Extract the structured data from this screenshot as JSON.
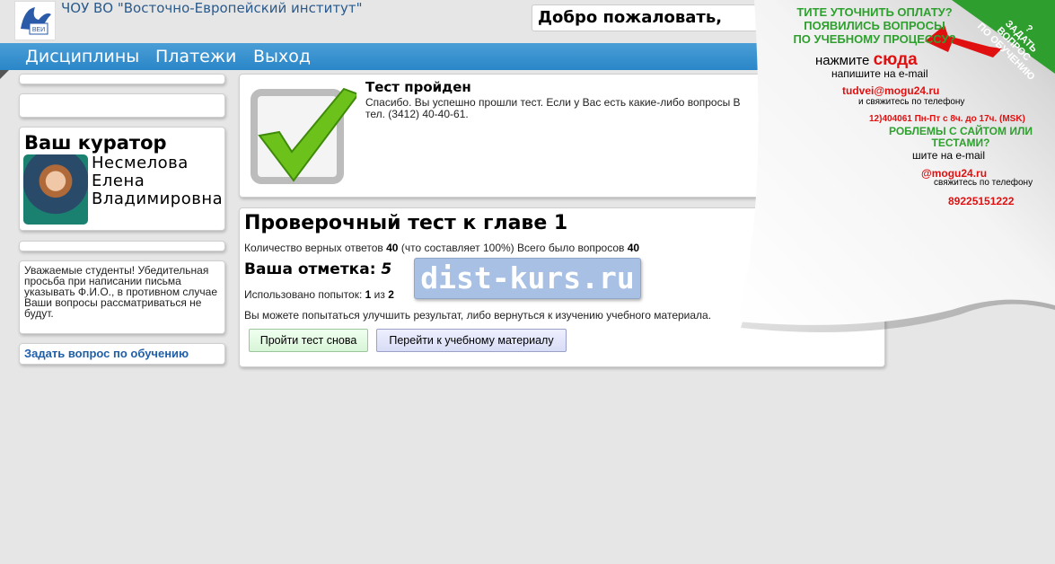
{
  "header": {
    "institute_name": "ЧОУ ВО \"Восточно-Европейский институт\"",
    "logo_text": "ВЕИ",
    "welcome": "Добро пожаловать,"
  },
  "nav": [
    "Дисциплины",
    "Платежи",
    "Выход"
  ],
  "curator": {
    "title": "Ваш куратор",
    "name_lines": [
      "Несмелова",
      "Елена",
      "Владимировна"
    ]
  },
  "notice": "Уважаемые студенты! Убедительная просьба при написании письма указывать Ф.И.О., в противном случае Ваши вопросы рассматриваться не будут.",
  "ask_link": "Задать вопрос по обучению",
  "passed": {
    "title": "Тест пройден",
    "text_1": "Спасибо. Вы успешно прошли тест. Если у Вас есть какие-либо вопросы В",
    "text_2": "тел. (3412) 40-40-61."
  },
  "test": {
    "title": "Проверочный тест к главе 1",
    "correct_label": "Количество верных ответов",
    "correct": "40",
    "percent_text": "(что составляет 100%) Всего было вопросов",
    "total": "40",
    "grade_label": "Ваша отметка:",
    "grade": "5",
    "attempts_label": "Использовано попыток:",
    "attempts_used": "1",
    "attempts_of": "из",
    "attempts_total": "2",
    "hint": "Вы можете попытаться улучшить результат, либо вернуться к изучению учебного материала.",
    "retry_button": "Пройти тест снова",
    "material_button": "Перейти к учебному материалу"
  },
  "watermark": "dist-kurs.ru",
  "promo": {
    "ribbon": [
      "?",
      "ЗАДАТЬ",
      "ВОПРОС",
      "ПО ОБУЧЕНИЮ"
    ],
    "q1": "ТИТЕ УТОЧНИТЬ ОПЛАТУ?",
    "q2": "ПОЯВИЛИСЬ ВОПРОСЫ",
    "q3": "ПО УЧЕБНОМУ ПРОЦЕССУ?",
    "press": "нажмите",
    "here": "сюда",
    "write": "напишите на e-mail",
    "email1": "tudvei@mogu24.ru",
    "call1": "и свяжитесь по телефону",
    "phone1": "12)404061 Пн-Пт с 8ч. до 17ч. (MSK)",
    "problems1": "РОБЛЕМЫ С САЙТОМ ИЛИ",
    "problems2": "ТЕСТАМИ?",
    "write2": "шите на e-mail",
    "email2": "@mogu24.ru",
    "call2": "свяжитесь по телефону",
    "phone2": "89225151222"
  }
}
